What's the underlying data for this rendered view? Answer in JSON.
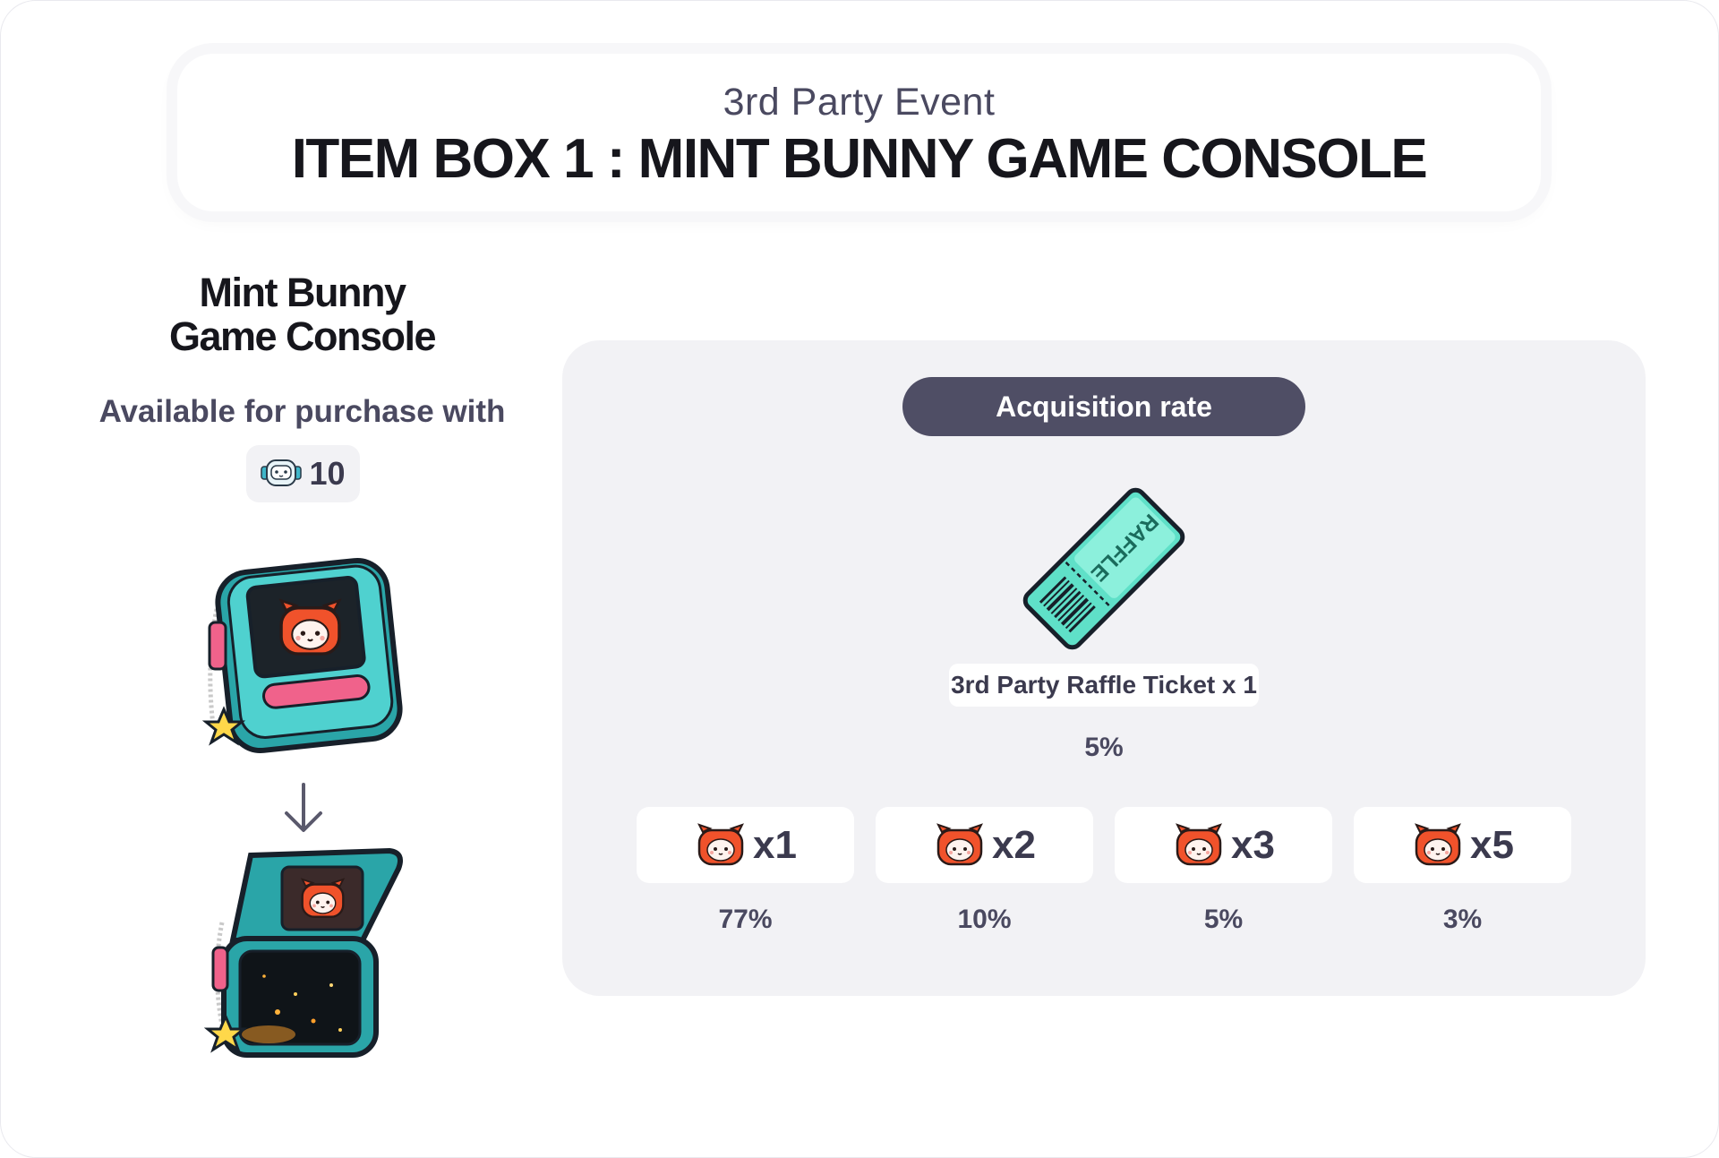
{
  "header": {
    "subtitle": "3rd Party Event",
    "title": "ITEM BOX 1 : MINT BUNNY GAME CONSOLE"
  },
  "item": {
    "name_line1": "Mint Bunny",
    "name_line2": "Game Console",
    "purchase_label": "Available for purchase with",
    "price": "10",
    "price_icon": "robot-coin-icon",
    "images": [
      "game-console-closed",
      "arrow-down-icon",
      "game-console-open"
    ]
  },
  "rates": {
    "title": "Acquisition rate",
    "ticket": {
      "icon": "raffle-ticket-icon",
      "ticket_text": "RAFFLE",
      "label": "3rd Party Raffle Ticket x 1",
      "rate": "5%"
    },
    "bunny_rewards": [
      {
        "icon": "red-bunny-icon",
        "qty": "x1",
        "rate": "77%"
      },
      {
        "icon": "red-bunny-icon",
        "qty": "x2",
        "rate": "10%"
      },
      {
        "icon": "red-bunny-icon",
        "qty": "x3",
        "rate": "5%"
      },
      {
        "icon": "red-bunny-icon",
        "qty": "x5",
        "rate": "3%"
      }
    ]
  },
  "colors": {
    "pill_bg": "#4f4e65",
    "panel_bg": "#f2f2f5",
    "ticket_mint": "#5fe0c8",
    "bunny_red": "#f0522b",
    "console_teal": "#3bc7c9"
  }
}
